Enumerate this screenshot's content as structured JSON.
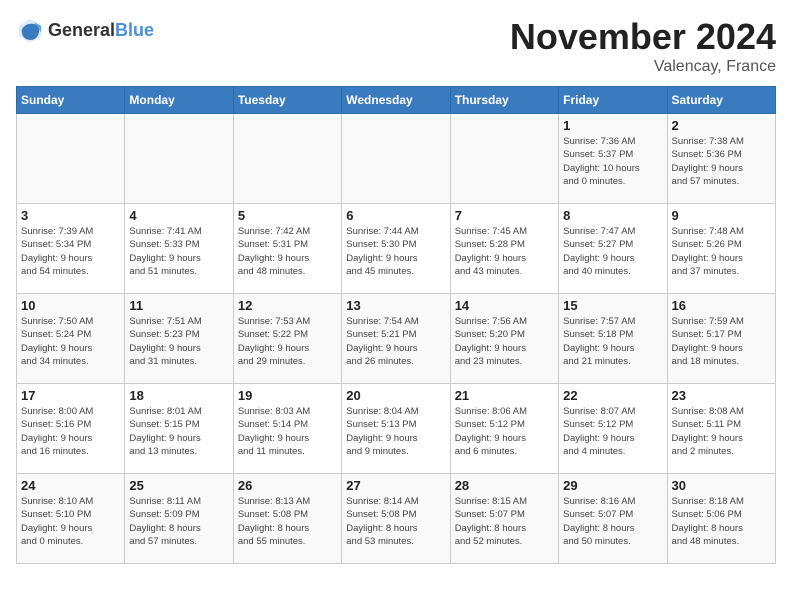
{
  "logo": {
    "general": "General",
    "blue": "Blue"
  },
  "title": "November 2024",
  "location": "Valencay, France",
  "weekdays": [
    "Sunday",
    "Monday",
    "Tuesday",
    "Wednesday",
    "Thursday",
    "Friday",
    "Saturday"
  ],
  "weeks": [
    [
      {
        "day": "",
        "info": ""
      },
      {
        "day": "",
        "info": ""
      },
      {
        "day": "",
        "info": ""
      },
      {
        "day": "",
        "info": ""
      },
      {
        "day": "",
        "info": ""
      },
      {
        "day": "1",
        "info": "Sunrise: 7:36 AM\nSunset: 5:37 PM\nDaylight: 10 hours\nand 0 minutes."
      },
      {
        "day": "2",
        "info": "Sunrise: 7:38 AM\nSunset: 5:36 PM\nDaylight: 9 hours\nand 57 minutes."
      }
    ],
    [
      {
        "day": "3",
        "info": "Sunrise: 7:39 AM\nSunset: 5:34 PM\nDaylight: 9 hours\nand 54 minutes."
      },
      {
        "day": "4",
        "info": "Sunrise: 7:41 AM\nSunset: 5:33 PM\nDaylight: 9 hours\nand 51 minutes."
      },
      {
        "day": "5",
        "info": "Sunrise: 7:42 AM\nSunset: 5:31 PM\nDaylight: 9 hours\nand 48 minutes."
      },
      {
        "day": "6",
        "info": "Sunrise: 7:44 AM\nSunset: 5:30 PM\nDaylight: 9 hours\nand 45 minutes."
      },
      {
        "day": "7",
        "info": "Sunrise: 7:45 AM\nSunset: 5:28 PM\nDaylight: 9 hours\nand 43 minutes."
      },
      {
        "day": "8",
        "info": "Sunrise: 7:47 AM\nSunset: 5:27 PM\nDaylight: 9 hours\nand 40 minutes."
      },
      {
        "day": "9",
        "info": "Sunrise: 7:48 AM\nSunset: 5:26 PM\nDaylight: 9 hours\nand 37 minutes."
      }
    ],
    [
      {
        "day": "10",
        "info": "Sunrise: 7:50 AM\nSunset: 5:24 PM\nDaylight: 9 hours\nand 34 minutes."
      },
      {
        "day": "11",
        "info": "Sunrise: 7:51 AM\nSunset: 5:23 PM\nDaylight: 9 hours\nand 31 minutes."
      },
      {
        "day": "12",
        "info": "Sunrise: 7:53 AM\nSunset: 5:22 PM\nDaylight: 9 hours\nand 29 minutes."
      },
      {
        "day": "13",
        "info": "Sunrise: 7:54 AM\nSunset: 5:21 PM\nDaylight: 9 hours\nand 26 minutes."
      },
      {
        "day": "14",
        "info": "Sunrise: 7:56 AM\nSunset: 5:20 PM\nDaylight: 9 hours\nand 23 minutes."
      },
      {
        "day": "15",
        "info": "Sunrise: 7:57 AM\nSunset: 5:18 PM\nDaylight: 9 hours\nand 21 minutes."
      },
      {
        "day": "16",
        "info": "Sunrise: 7:59 AM\nSunset: 5:17 PM\nDaylight: 9 hours\nand 18 minutes."
      }
    ],
    [
      {
        "day": "17",
        "info": "Sunrise: 8:00 AM\nSunset: 5:16 PM\nDaylight: 9 hours\nand 16 minutes."
      },
      {
        "day": "18",
        "info": "Sunrise: 8:01 AM\nSunset: 5:15 PM\nDaylight: 9 hours\nand 13 minutes."
      },
      {
        "day": "19",
        "info": "Sunrise: 8:03 AM\nSunset: 5:14 PM\nDaylight: 9 hours\nand 11 minutes."
      },
      {
        "day": "20",
        "info": "Sunrise: 8:04 AM\nSunset: 5:13 PM\nDaylight: 9 hours\nand 9 minutes."
      },
      {
        "day": "21",
        "info": "Sunrise: 8:06 AM\nSunset: 5:12 PM\nDaylight: 9 hours\nand 6 minutes."
      },
      {
        "day": "22",
        "info": "Sunrise: 8:07 AM\nSunset: 5:12 PM\nDaylight: 9 hours\nand 4 minutes."
      },
      {
        "day": "23",
        "info": "Sunrise: 8:08 AM\nSunset: 5:11 PM\nDaylight: 9 hours\nand 2 minutes."
      }
    ],
    [
      {
        "day": "24",
        "info": "Sunrise: 8:10 AM\nSunset: 5:10 PM\nDaylight: 9 hours\nand 0 minutes."
      },
      {
        "day": "25",
        "info": "Sunrise: 8:11 AM\nSunset: 5:09 PM\nDaylight: 8 hours\nand 57 minutes."
      },
      {
        "day": "26",
        "info": "Sunrise: 8:13 AM\nSunset: 5:08 PM\nDaylight: 8 hours\nand 55 minutes."
      },
      {
        "day": "27",
        "info": "Sunrise: 8:14 AM\nSunset: 5:08 PM\nDaylight: 8 hours\nand 53 minutes."
      },
      {
        "day": "28",
        "info": "Sunrise: 8:15 AM\nSunset: 5:07 PM\nDaylight: 8 hours\nand 52 minutes."
      },
      {
        "day": "29",
        "info": "Sunrise: 8:16 AM\nSunset: 5:07 PM\nDaylight: 8 hours\nand 50 minutes."
      },
      {
        "day": "30",
        "info": "Sunrise: 8:18 AM\nSunset: 5:06 PM\nDaylight: 8 hours\nand 48 minutes."
      }
    ]
  ]
}
